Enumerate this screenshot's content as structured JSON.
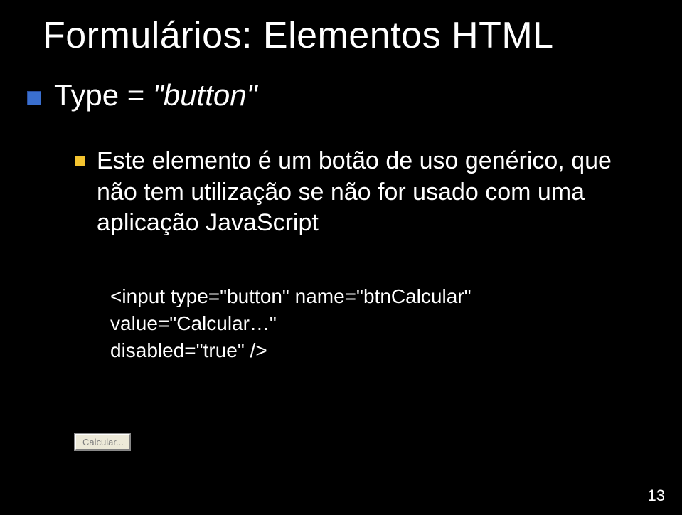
{
  "title": "Formulários: Elementos HTML",
  "bullet_l1": {
    "prefix": "Type = ",
    "value": "\"button\""
  },
  "bullet_l2": "Este elemento é um botão de uso genérico, que não tem utilização se não for usado com uma aplicação JavaScript",
  "code": {
    "line1": "<input type=\"button\" name=\"btnCalcular\" value=\"Calcular…\"",
    "line2": "disabled=\"true\" />"
  },
  "demo_button_label": "Calcular...",
  "page_number": "13"
}
